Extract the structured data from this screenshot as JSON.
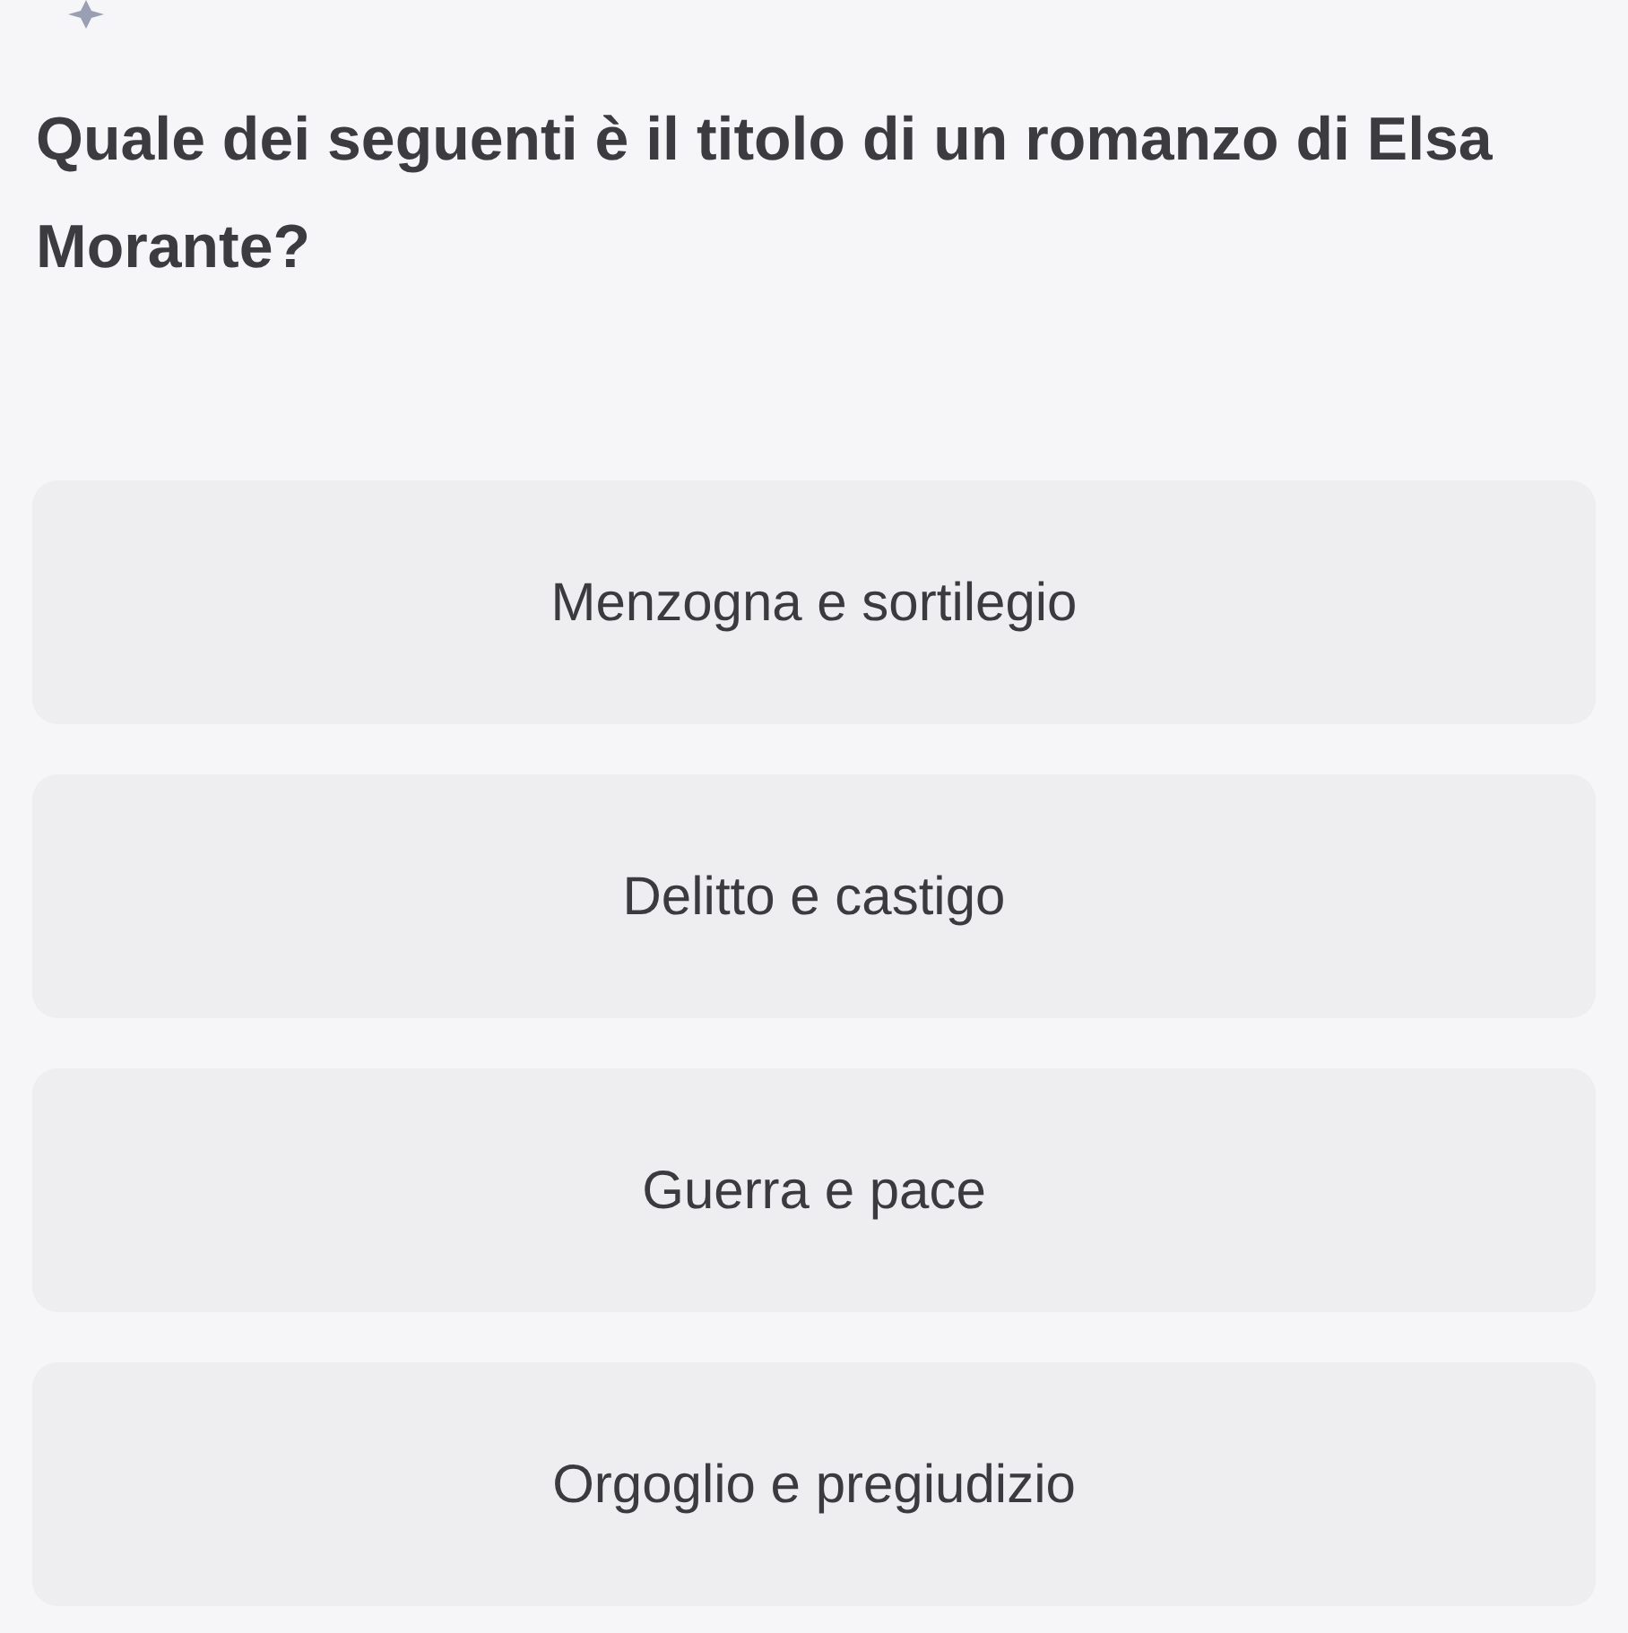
{
  "question": "Quale dei seguenti è il titolo di un romanzo di Elsa Morante?",
  "options": [
    {
      "label": "Menzogna e sortilegio",
      "selected": false
    },
    {
      "label": "Delitto e castigo",
      "selected": false
    },
    {
      "label": "Guerra e pace",
      "selected": false
    },
    {
      "label": "Orgoglio e pregiudizio",
      "selected": false
    }
  ]
}
